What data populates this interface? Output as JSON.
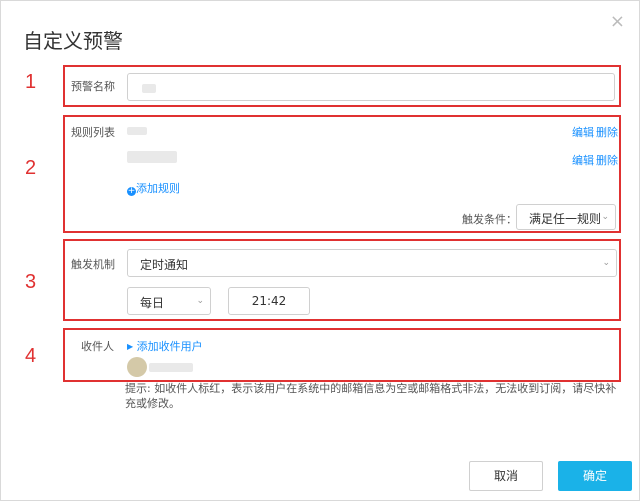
{
  "dialog": {
    "title": "自定义预警",
    "close_glyph": "×"
  },
  "markers": [
    "1",
    "2",
    "3",
    "4"
  ],
  "name_section": {
    "label": "预警名称",
    "value": ""
  },
  "rules_section": {
    "label": "规则列表",
    "rules": [
      {
        "edit": "编辑",
        "delete": "删除"
      },
      {
        "edit": "编辑",
        "delete": "删除"
      }
    ],
    "add_rule": "添加规则",
    "trigger_label": "触发条件：",
    "trigger_value": "满足任一规则"
  },
  "mechanism_section": {
    "label": "触发机制",
    "mode": "定时通知",
    "frequency": "每日",
    "time": "21:42"
  },
  "recipient_section": {
    "label": "收件人",
    "add_user": "添加收件用户",
    "hint": "提示: 如收件人标红，表示该用户在系统中的邮箱信息为空或邮箱格式非法，无法收到订阅，请尽快补充或修改。"
  },
  "footer": {
    "cancel": "取消",
    "confirm": "确定"
  },
  "colors": {
    "accent": "#1ab2e8",
    "highlight": "#e03131",
    "link": "#1890ff"
  }
}
